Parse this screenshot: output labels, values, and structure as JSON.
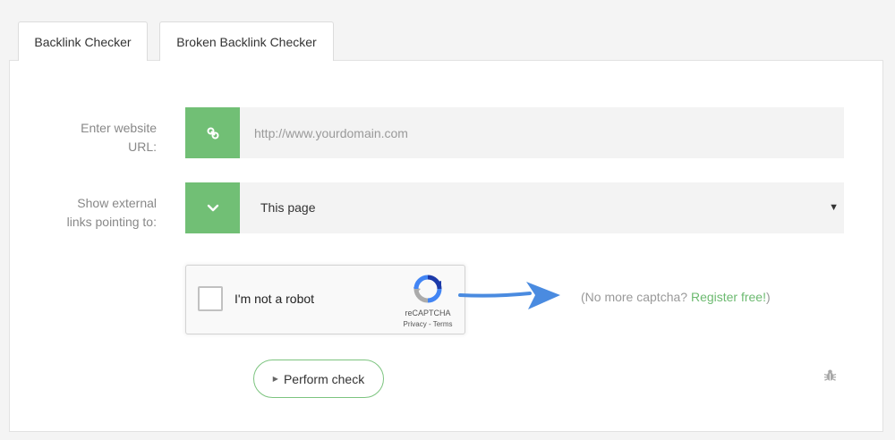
{
  "tabs": [
    {
      "label": "Backlink Checker"
    },
    {
      "label": "Broken Backlink Checker"
    }
  ],
  "form": {
    "url_label_line1": "Enter website",
    "url_label_line2": "URL:",
    "url_placeholder": "http://www.yourdomain.com",
    "url_value": "",
    "url_icon": "link-icon",
    "links_label_line1": "Show external",
    "links_label_line2": "links pointing to:",
    "links_icon": "chevron-down-icon",
    "links_selected": "This page"
  },
  "captcha": {
    "label": "I'm not a robot",
    "brand": "reCAPTCHA",
    "privacy": "Privacy",
    "separator": " - ",
    "terms": "Terms"
  },
  "note": {
    "prefix": "(No more captcha? ",
    "link": "Register free!",
    "suffix": ")"
  },
  "actions": {
    "perform_label": "Perform check"
  },
  "colors": {
    "accent_green": "#71bf75",
    "link_green": "#6cba70",
    "arrow_blue": "#4a8be0"
  }
}
